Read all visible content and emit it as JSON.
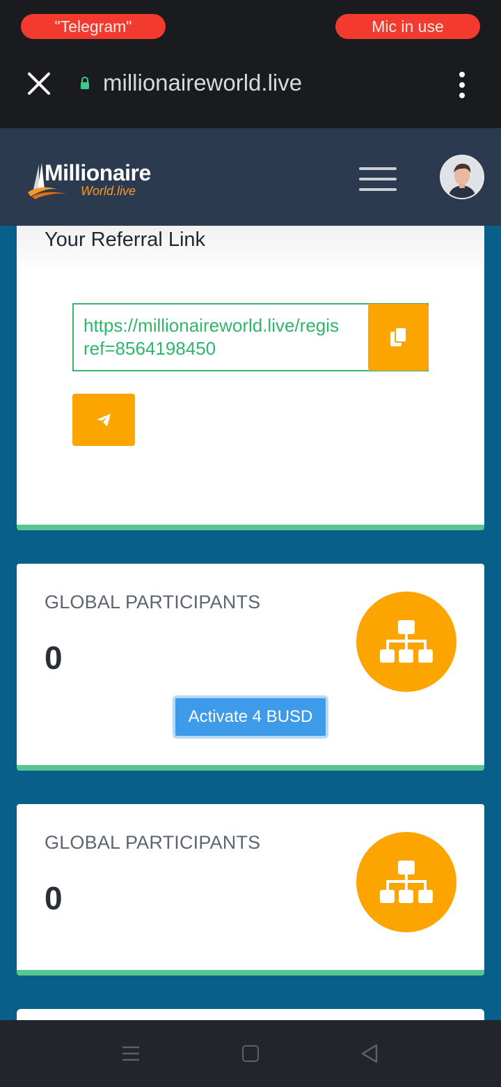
{
  "status_bar": {
    "left_pill": "\"Telegram\"",
    "right_pill": "Mic in use"
  },
  "browser": {
    "url": "millionaireworld.live",
    "close_icon": "close-icon",
    "lock_icon": "lock-icon",
    "menu_icon": "more-vert-icon"
  },
  "header": {
    "logo_top": "Millionaire",
    "logo_bottom": "World.live",
    "menu_icon": "hamburger-icon",
    "avatar_icon": "avatar"
  },
  "referral": {
    "title": "Your Referral Link",
    "link": "https://millionaireworld.live/regis\nref=8564198450",
    "copy_icon": "copy-icon",
    "share_icon": "telegram-send-icon"
  },
  "cards": [
    {
      "label": "GLOBAL PARTICIPANTS",
      "value": "0",
      "button": "Activate 4 BUSD",
      "icon": "sitemap-icon"
    },
    {
      "label": "GLOBAL PARTICIPANTS",
      "value": "0",
      "icon": "sitemap-icon"
    }
  ],
  "colors": {
    "accent_orange": "#fca400",
    "accent_green": "#56c78e",
    "link_green": "#2fb66a",
    "page_bg": "#075f8a",
    "header_bg": "#2b3a4f",
    "button_blue": "#3e9be9",
    "pill_red": "#f23b2e"
  }
}
